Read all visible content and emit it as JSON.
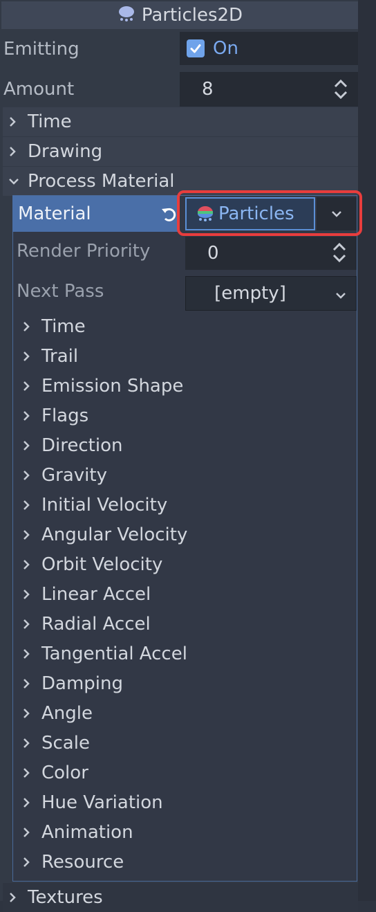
{
  "node": {
    "title": "Particles2D",
    "icon": "particles-icon"
  },
  "emitting": {
    "label": "Emitting",
    "value": "On",
    "checked": true
  },
  "amount": {
    "label": "Amount",
    "value": "8"
  },
  "sections": {
    "time": "Time",
    "drawing": "Drawing",
    "process_material": "Process Material",
    "textures": "Textures"
  },
  "material": {
    "label": "Material",
    "resource_name": "Particles",
    "resource_icon": "particles-material-icon"
  },
  "render_priority": {
    "label": "Render Priority",
    "value": "0"
  },
  "next_pass": {
    "label": "Next Pass",
    "value": "[empty]"
  },
  "material_sections": [
    "Time",
    "Trail",
    "Emission Shape",
    "Flags",
    "Direction",
    "Gravity",
    "Initial Velocity",
    "Angular Velocity",
    "Orbit Velocity",
    "Linear Accel",
    "Radial Accel",
    "Tangential Accel",
    "Damping",
    "Angle",
    "Scale",
    "Color",
    "Hue Variation",
    "Animation",
    "Resource"
  ],
  "colors": {
    "accent": "#6fa3ea",
    "selection": "#4a6fa8",
    "highlight": "#e83d3d"
  }
}
